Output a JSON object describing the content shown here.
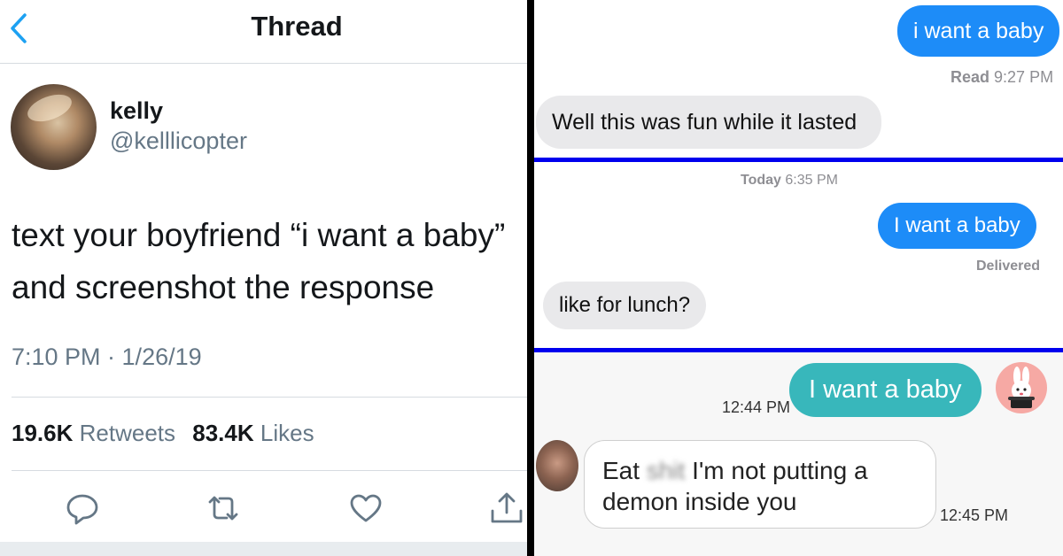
{
  "tweet": {
    "header_title": "Thread",
    "author_name": "kelly",
    "author_handle": "@kelllicopter",
    "text_line1": "text your boyfriend “i want a baby”",
    "text_line2": "and screenshot the response",
    "timestamp": "7:10 PM · 1/26/19",
    "retweets_count": "19.6K",
    "retweets_label": "Retweets",
    "likes_count": "83.4K",
    "likes_label": "Likes",
    "icons": [
      "chevron-left-icon",
      "reply-icon",
      "retweet-icon",
      "like-icon",
      "share-icon"
    ],
    "accent_color": "#1da1f2"
  },
  "chats": {
    "section1": {
      "sent_message": "i want a baby",
      "read_label": "Read",
      "read_time": "9:27 PM",
      "received_message": "Well this was fun while it lasted"
    },
    "section2": {
      "date_label": "Today",
      "date_time": "6:35 PM",
      "sent_message": "I want a baby",
      "status": "Delivered",
      "received_message": "like for lunch?"
    },
    "section3": {
      "sent_message": "I want a baby",
      "sent_time": "12:44 PM",
      "received_pre": "Eat",
      "received_censored": "shit",
      "received_post": "I'm not putting a demon inside you",
      "received_time": "12:45 PM"
    },
    "divider_color": "#0000ee",
    "imessage_blue": "#1d8cf8",
    "teal_bubble": "#38b7bb"
  }
}
